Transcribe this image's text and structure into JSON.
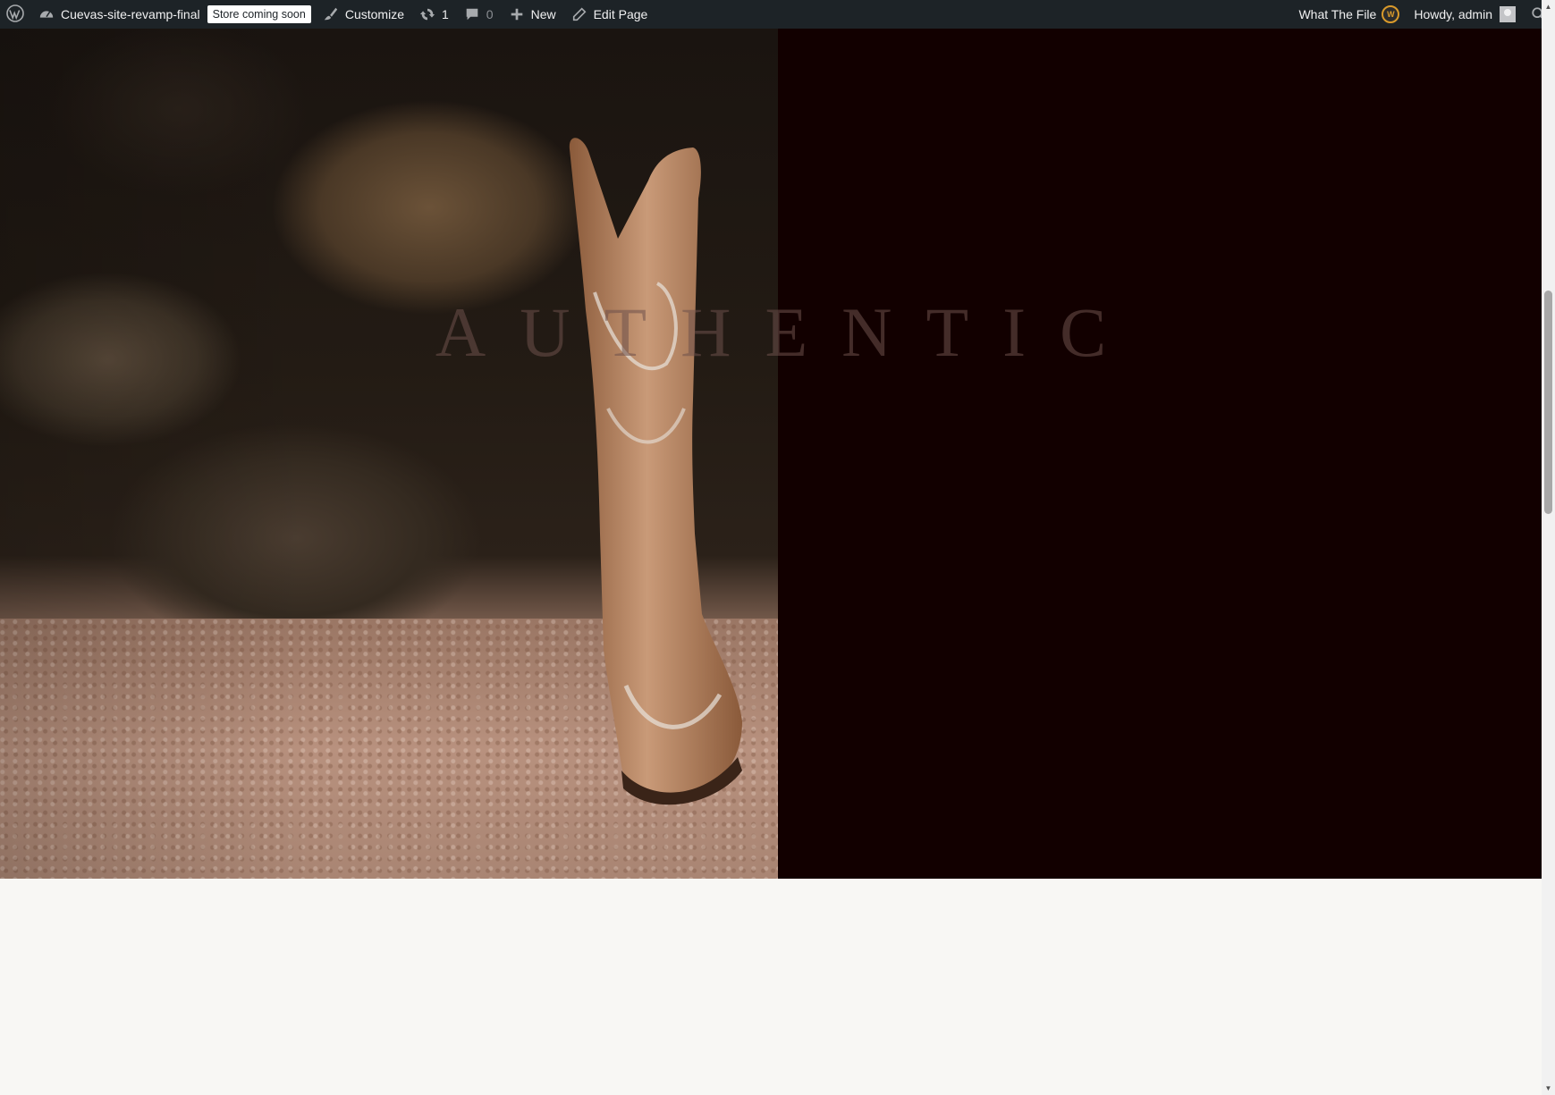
{
  "adminbar": {
    "site_name": "Cuevas-site-revamp-final",
    "store_badge": "Store coming soon",
    "customize_label": "Customize",
    "updates_count": "1",
    "comments_count": "0",
    "new_label": "New",
    "edit_label": "Edit Page",
    "plugin_label": "What The File",
    "greeting": "Howdy, admin"
  },
  "hero": {
    "headline": "AUTHENTIC"
  },
  "colors": {
    "adminbar_bg": "#1d2327",
    "hero_right_bg": "#120000",
    "page_bg": "#f8f7f4"
  },
  "icons": [
    "wordpress-icon",
    "dashboard-icon",
    "brush-icon",
    "updates-icon",
    "comment-icon",
    "plus-icon",
    "pencil-icon",
    "search-icon"
  ]
}
